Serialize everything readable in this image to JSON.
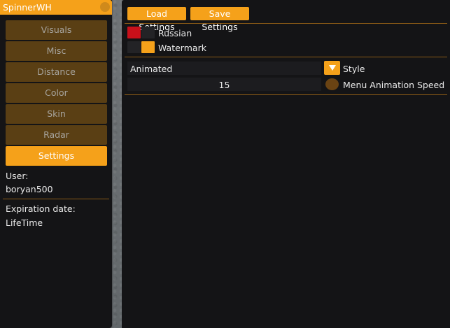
{
  "left_window": {
    "title": "SpinnerWH",
    "nav": [
      {
        "label": "Visuals",
        "active": false
      },
      {
        "label": "Misc",
        "active": false
      },
      {
        "label": "Distance",
        "active": false
      },
      {
        "label": "Color",
        "active": false
      },
      {
        "label": "Skin",
        "active": false
      },
      {
        "label": "Radar",
        "active": false
      },
      {
        "label": "Settings",
        "active": true
      }
    ],
    "user_label": "User:",
    "user_value": "boryan500",
    "expiration_label": "Expiration date:",
    "expiration_value": "LifeTime"
  },
  "right_window": {
    "load_button": "Load Settings",
    "save_button": "Save Settings",
    "toggles": [
      {
        "label": "Russian",
        "state": "off",
        "colors": [
          "#c8101a",
          "#232326"
        ]
      },
      {
        "label": "Watermark",
        "state": "on",
        "colors": [
          "#232326",
          "#f5a11a"
        ]
      }
    ],
    "style_combo": {
      "value": "Animated",
      "label": "Style"
    },
    "speed_slider": {
      "value": "15",
      "label": "Menu Animation Speed"
    }
  },
  "colors": {
    "accent": "#f5a11a",
    "inactive_button": "#5a3f14",
    "panel_bg": "#141416",
    "field_bg": "#1c1c1f",
    "separator": "#8a5a16"
  }
}
